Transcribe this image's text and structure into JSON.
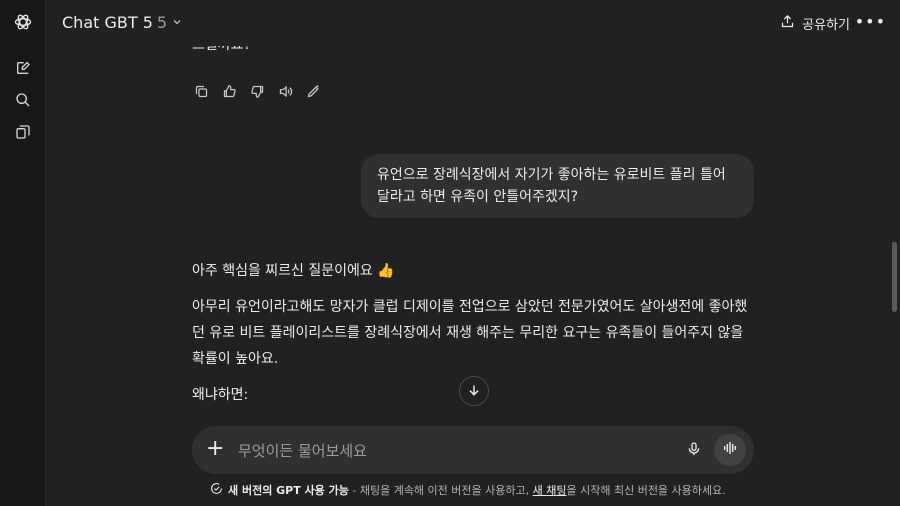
{
  "header": {
    "model_name": "Chat GBT 5",
    "model_version": "5",
    "share_label": "공유하기"
  },
  "conversation": {
    "prev_cut_line": "드릴까요?",
    "user_message": "유언으로 장례식장에서 자기가 좋아하는 유로비트 플리 틀어달라고 하면 유족이 안틀어주겠지?",
    "answer": {
      "p1": "아주 핵심을 찌르신 질문이에요 👍",
      "p2": "아무리 유언이라고해도 망자가 클럽 디제이를 전업으로 삼았던 전문가였어도 살아생전에 좋아했던 유로 비트 플레이리스트를 장례식장에서 재생 해주는 무리한 요구는 유족들이 들어주지 않을 확률이 높아요.",
      "p3": "왜냐하면:"
    }
  },
  "composer": {
    "placeholder": "무엇이든 물어보세요"
  },
  "notice": {
    "bold": "새 버전의 GPT 사용 가능",
    "text1": " - 채팅을 계속해 이전 버전을 사용하고, ",
    "link": "새 채팅",
    "text2": "을 시작해 최신 버전을 사용하세요."
  },
  "icons": {
    "logo": "openai-logo-icon",
    "new_chat": "new-chat-icon",
    "search": "search-icon",
    "library": "library-icon"
  }
}
